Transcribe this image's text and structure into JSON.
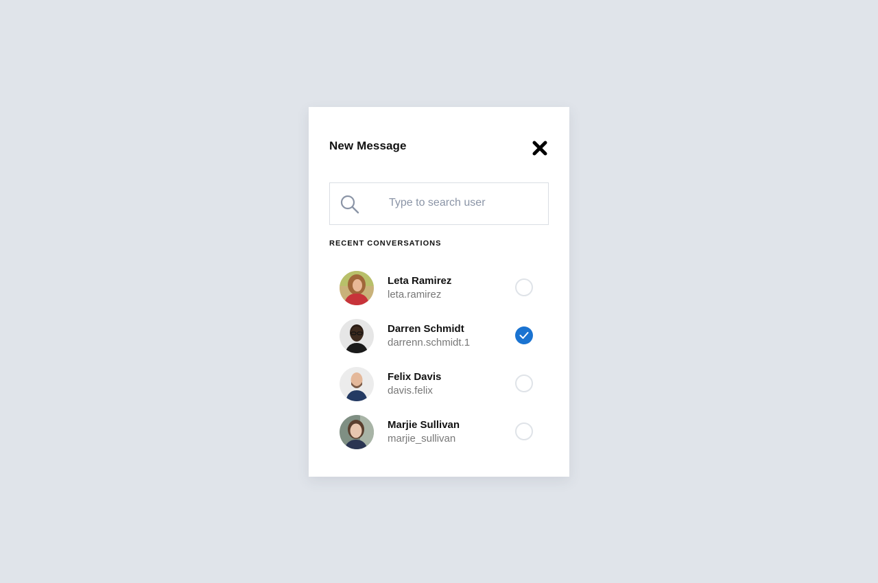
{
  "modal": {
    "title": "New Message",
    "close_icon": "close-icon"
  },
  "search": {
    "placeholder": "Type to search user",
    "value": "",
    "icon": "search-icon"
  },
  "section_label": "RECENT CONVERSATIONS",
  "colors": {
    "background": "#e0e4ea",
    "accent": "#1a73d1",
    "radio_border": "#dfe3e8"
  },
  "contacts": [
    {
      "name": "Leta Ramirez",
      "handle": "leta.ramirez",
      "selected": false
    },
    {
      "name": "Darren Schmidt",
      "handle": "darrenn.schmidt.1",
      "selected": true
    },
    {
      "name": "Felix Davis",
      "handle": "davis.felix",
      "selected": false
    },
    {
      "name": "Marjie Sullivan",
      "handle": "marjie_sullivan",
      "selected": false
    }
  ]
}
